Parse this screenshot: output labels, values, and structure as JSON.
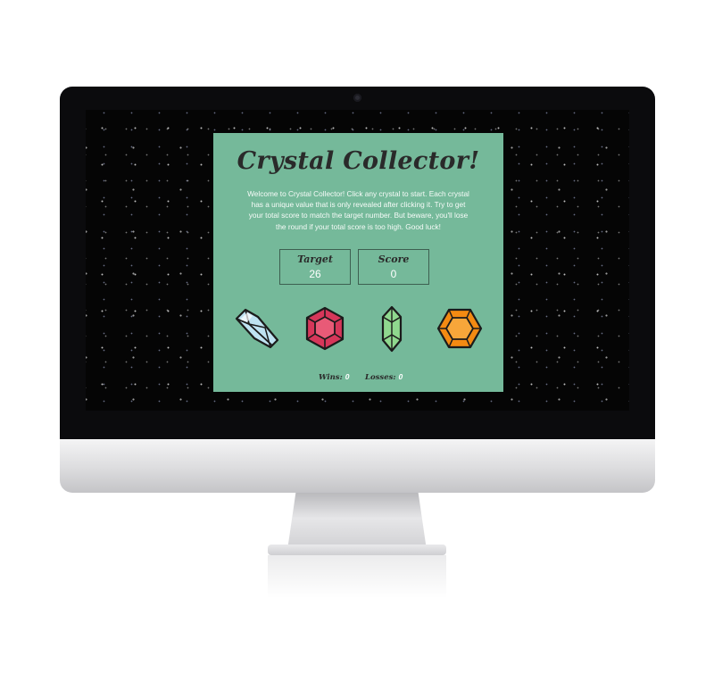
{
  "game": {
    "title": "Crystal Collector!",
    "intro": "Welcome to Crystal Collector! Click any crystal to start. Each crystal has a unique value that is only revealed after clicking it. Try to get your total score to match the target number. But beware, you'll lose the round if your total score is too high. Good luck!",
    "target_label": "Target",
    "target_value": "26",
    "score_label": "Score",
    "score_value": "0",
    "wins_label": "Wins:",
    "wins_value": "0",
    "losses_label": "Losses:",
    "losses_value": "0",
    "crystals": [
      {
        "icon": "blue-crystal-icon",
        "color": "#bfe3f2"
      },
      {
        "icon": "red-crystal-icon",
        "color": "#d6375a"
      },
      {
        "icon": "green-crystal-icon",
        "color": "#8fd88e"
      },
      {
        "icon": "orange-crystal-icon",
        "color": "#f38a12"
      }
    ]
  },
  "colors": {
    "card_background": "#75b99a",
    "title_text": "#2a2a2a",
    "screen_background": "#050505"
  }
}
